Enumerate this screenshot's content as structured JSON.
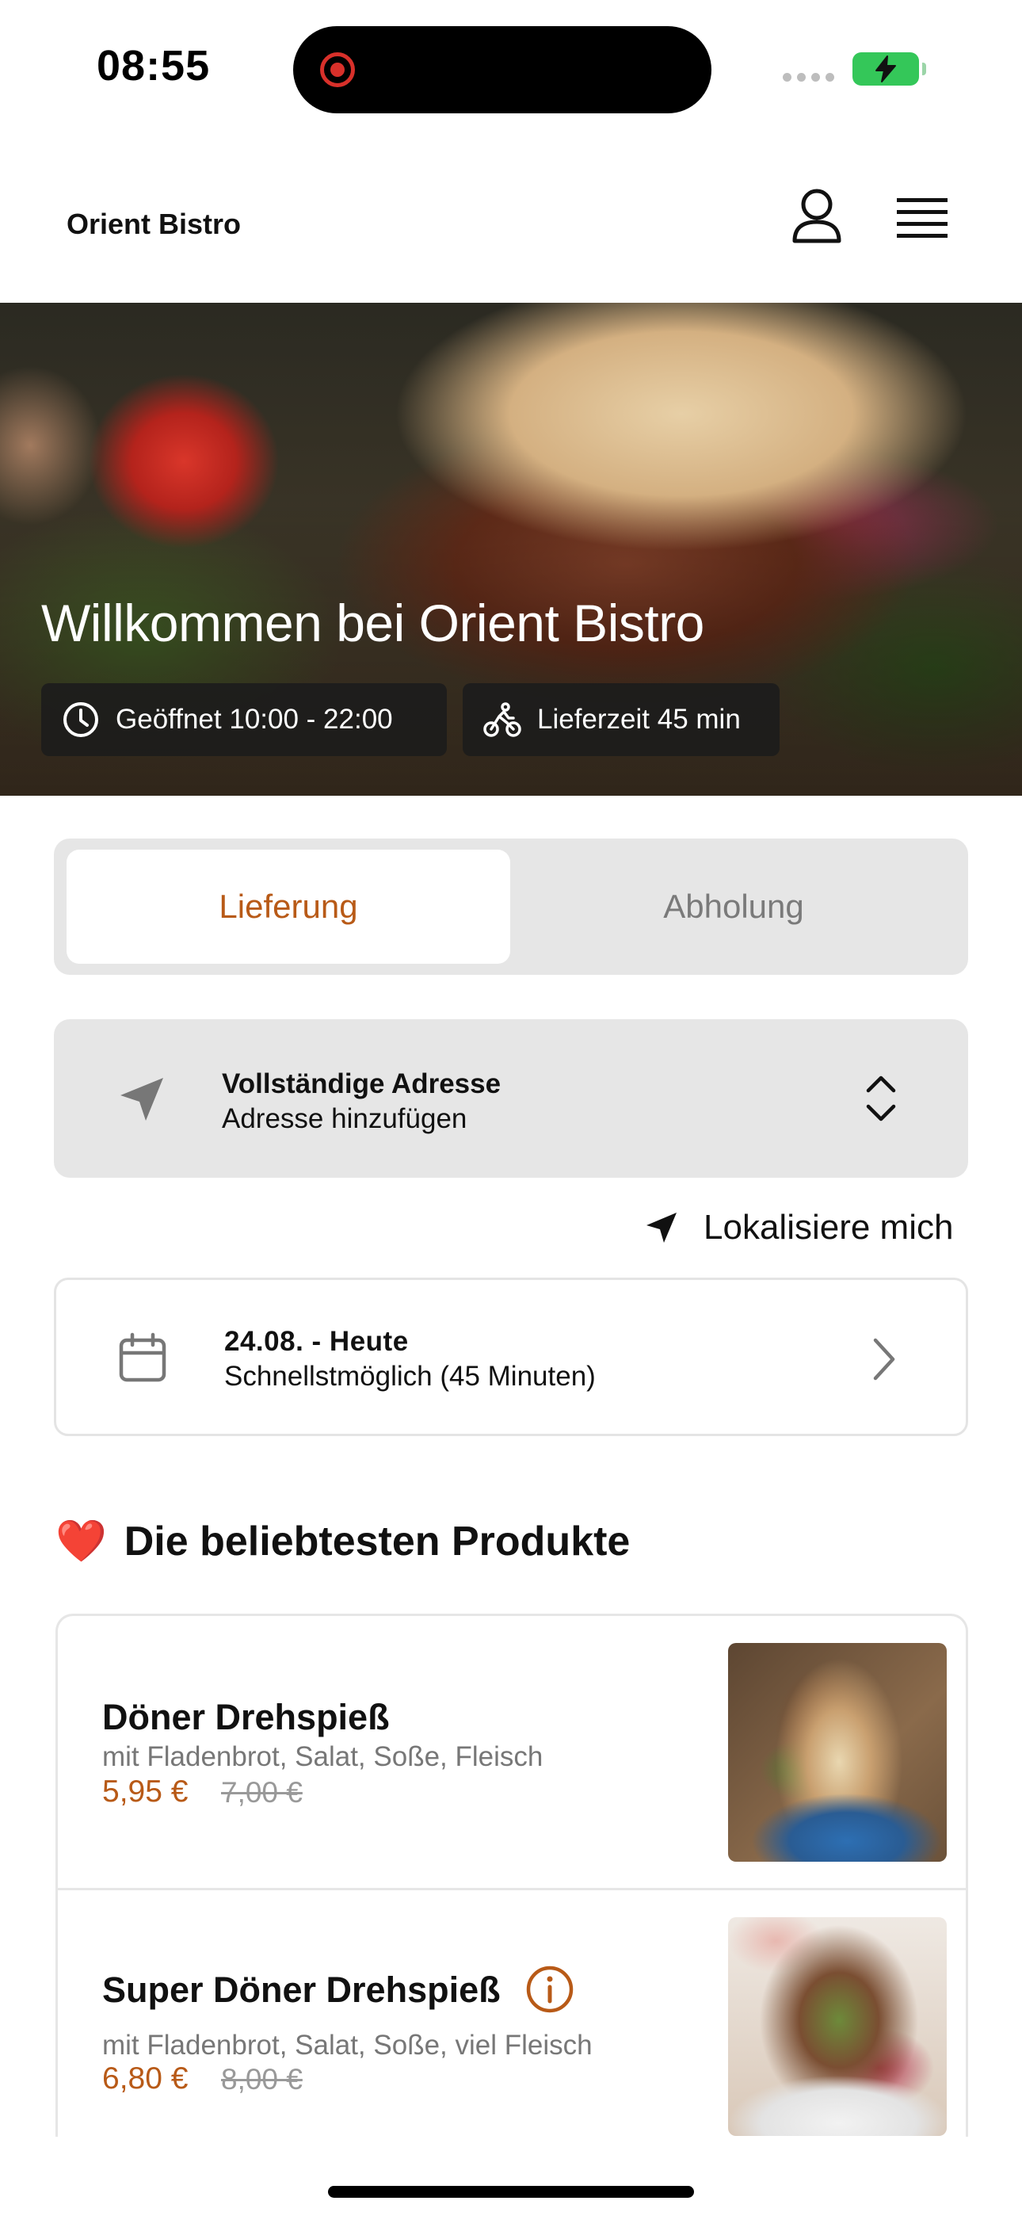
{
  "status_bar": {
    "time": "08:55"
  },
  "header": {
    "brand": "Orient Bistro",
    "icons": [
      "user-icon",
      "menu-icon"
    ]
  },
  "hero": {
    "title": "Willkommen bei Orient Bistro",
    "hours_label": "Geöffnet 10:00 - 22:00",
    "delivery_label": "Lieferzeit 45 min"
  },
  "order_mode": {
    "options": [
      "Lieferung",
      "Abholung"
    ],
    "selected": "Lieferung"
  },
  "address": {
    "title": "Vollständige Adresse",
    "subtitle": "Adresse hinzufügen"
  },
  "locate": {
    "label": "Lokalisiere mich"
  },
  "schedule": {
    "date": "24.08. - Heute",
    "time": "Schnellstmöglich (45 Minuten)"
  },
  "popular": {
    "emoji": "❤️",
    "title": "Die beliebtesten Produkte",
    "items": [
      {
        "name": "Döner Drehspieß",
        "description": "mit Fladenbrot, Salat, Soße, Fleisch",
        "price": "5,95 €",
        "old_price": "7,00 €"
      },
      {
        "name": "Super Döner Drehspieß",
        "description": "mit Fladenbrot, Salat, Soße, viel Fleisch",
        "price": "6,80 €",
        "old_price": "8,00 €"
      }
    ]
  },
  "colors": {
    "accent": "#b85a17",
    "panel": "#e6e6e6",
    "chip": "#1c1c1c",
    "battery": "#34c759"
  }
}
